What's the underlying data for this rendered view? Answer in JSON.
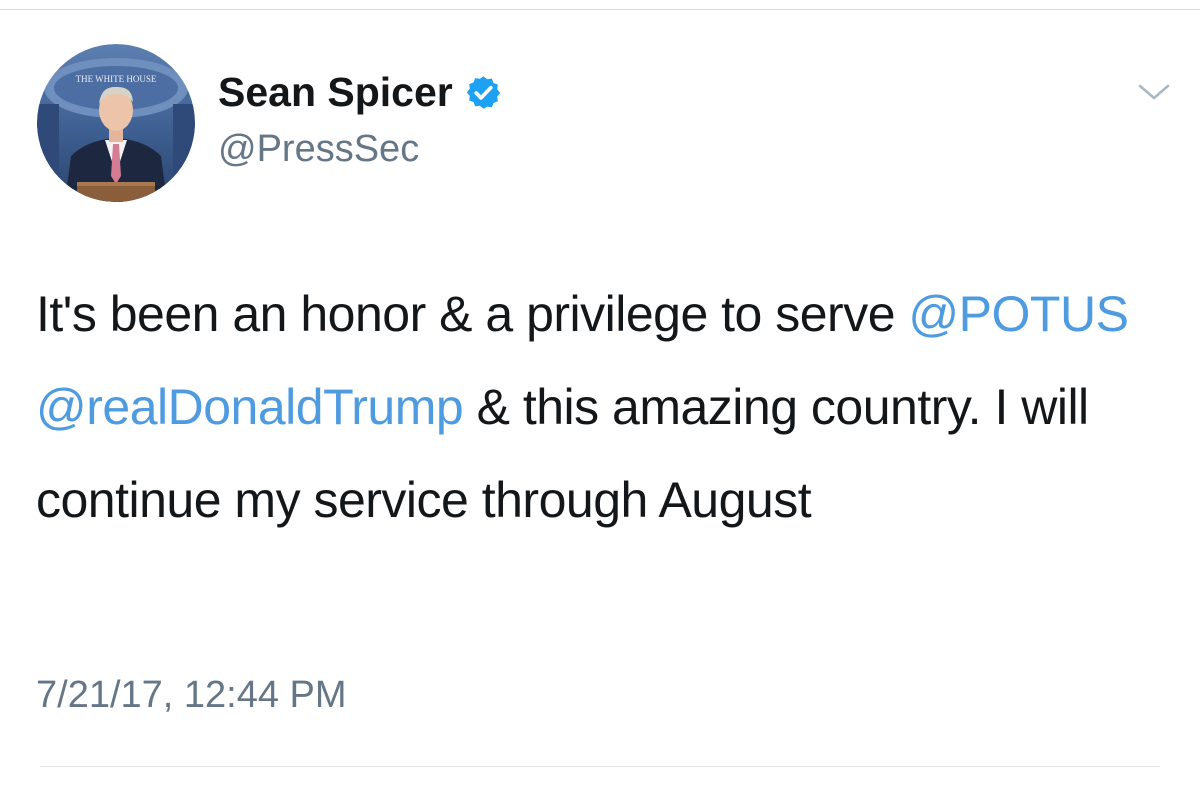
{
  "tweet": {
    "author": {
      "display_name": "Sean Spicer",
      "handle": "@PressSec",
      "verified": true,
      "avatar_icon": "profile-photo",
      "avatar_backdrop_text": "THE WHITE HOUSE"
    },
    "menu_icon": "chevron-down-icon",
    "text_segments": [
      {
        "kind": "text",
        "value": "It's been an honor & a privilege to serve "
      },
      {
        "kind": "mention",
        "value": "@POTUS"
      },
      {
        "kind": "text",
        "value": " "
      },
      {
        "kind": "mention",
        "value": "@realDonaldTrump"
      },
      {
        "kind": "text",
        "value": " & this amazing country. I will continue my service through August"
      }
    ],
    "timestamp": "7/21/17, 12:44 PM"
  },
  "colors": {
    "text": "#14171a",
    "secondary": "#657786",
    "link": "#4f9be0",
    "verified_badge": "#1da1f2",
    "divider": "#e3e7eb"
  }
}
